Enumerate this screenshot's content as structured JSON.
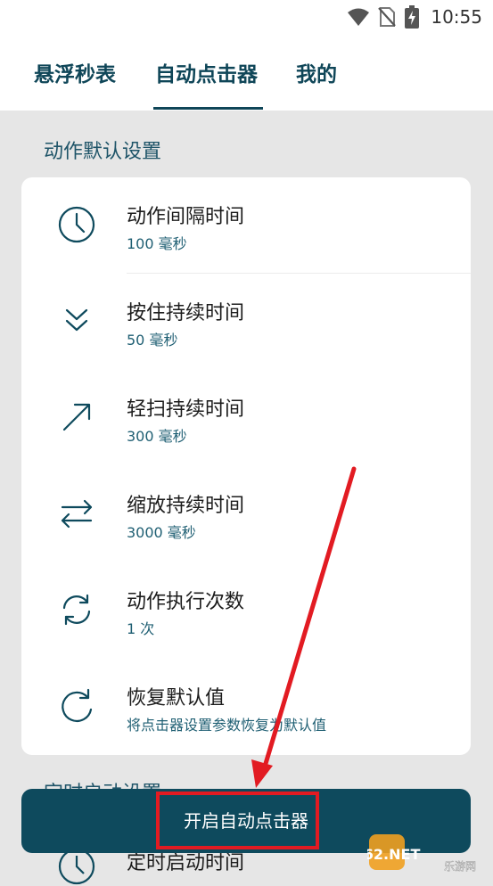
{
  "status_bar": {
    "time": "10:55",
    "icons": [
      "wifi-icon",
      "no-sim-icon",
      "battery-charging-icon"
    ]
  },
  "tabs": [
    {
      "label": "悬浮秒表",
      "active": false
    },
    {
      "label": "自动点击器",
      "active": true
    },
    {
      "label": "我的",
      "active": false
    }
  ],
  "section_title": "动作默认设置",
  "items": [
    {
      "title": "动作间隔时间",
      "subtitle": "100 毫秒",
      "icon": "clock-icon"
    },
    {
      "title": "按住持续时间",
      "subtitle": "50 毫秒",
      "icon": "double-chevron-down-icon"
    },
    {
      "title": "轻扫持续时间",
      "subtitle": "300 毫秒",
      "icon": "arrow-up-right-icon"
    },
    {
      "title": "缩放持续时间",
      "subtitle": "3000 毫秒",
      "icon": "swap-horizontal-icon"
    },
    {
      "title": "动作执行次数",
      "subtitle": "1 次",
      "icon": "sync-icon"
    },
    {
      "title": "恢复默认值",
      "subtitle": "将点击器设置参数恢复为默认值",
      "icon": "restore-icon"
    }
  ],
  "section2_title": "定时启动设置",
  "partial_item_title": "定时启动时间",
  "start_button_label": "开启自动点击器",
  "watermark": {
    "text": "962.NET",
    "caption": "乐游网"
  },
  "colors": {
    "primary": "#0e4a5d",
    "accent_text": "#1f5f73",
    "highlight": "#e21b22",
    "background": "#e6e6e6"
  }
}
